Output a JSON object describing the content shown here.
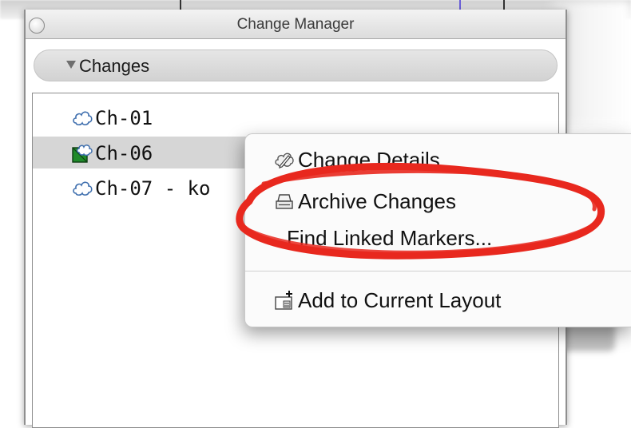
{
  "window": {
    "title": "Change Manager"
  },
  "section": {
    "label": "Changes",
    "expanded": true
  },
  "changes": [
    {
      "label": "Ch-01",
      "icon": "cloud-icon",
      "selected": false
    },
    {
      "label": "Ch-06",
      "icon": "cloud-map-icon",
      "selected": true
    },
    {
      "label": "Ch-07 - ko",
      "icon": "cloud-icon",
      "selected": false
    }
  ],
  "context_menu": {
    "items": [
      {
        "label": "Change Details",
        "icon": "pencil-cloud-icon"
      },
      {
        "label": "Archive Changes",
        "icon": "archive-icon"
      },
      {
        "label": "Find Linked Markers...",
        "icon": ""
      },
      {
        "label": "Add to Current Layout",
        "icon": "add-to-layout-icon"
      }
    ]
  },
  "annotation": {
    "color": "#e8281e",
    "highlighted_item": "Archive Changes"
  }
}
